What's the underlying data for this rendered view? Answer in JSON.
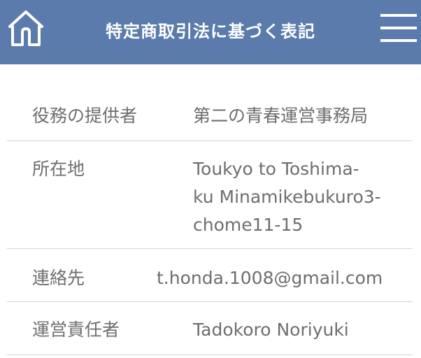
{
  "header": {
    "title": "特定商取引法に基づく表記",
    "background_color": "#5a7bab",
    "home_icon": "home-icon",
    "menu_icon": "hamburger-menu-icon"
  },
  "table": {
    "rows": [
      {
        "label": "役務の提供者",
        "value": "第二の青春運営事務局"
      },
      {
        "label": "所在地",
        "value_lines": [
          "Toukyo to Toshima-",
          "ku Minamikebukuro3-",
          "chome11-15"
        ]
      },
      {
        "label": "連絡先",
        "value": "t.honda.1008@gmail.com"
      },
      {
        "label": "運営責任者",
        "value": "Tadokoro Noriyuki"
      }
    ]
  }
}
